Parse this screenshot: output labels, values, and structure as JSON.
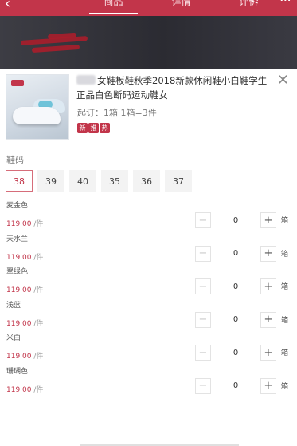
{
  "header": {
    "tabs": [
      {
        "label": "商品",
        "active": true
      },
      {
        "label": "详情",
        "active": false
      },
      {
        "label": "评价",
        "active": false
      }
    ]
  },
  "product": {
    "title": "女鞋板鞋秋季2018新款休闲鞋小白鞋学生正品白色断码运动鞋女",
    "moq": "起订：1箱 1箱=3件",
    "badges": [
      "新",
      "推",
      "热"
    ]
  },
  "size_section": {
    "label": "鞋码",
    "options": [
      "38",
      "39",
      "40",
      "35",
      "36",
      "37"
    ],
    "selected": "38"
  },
  "variants": [
    {
      "color": "麦金色",
      "price": "119.00",
      "unit": "/件",
      "qty": "0"
    },
    {
      "color": "天水兰",
      "price": "119.00",
      "unit": "/件",
      "qty": "0"
    },
    {
      "color": "翠绿色",
      "price": "119.00",
      "unit": "/件",
      "qty": "0"
    },
    {
      "color": "浅蓝",
      "price": "119.00",
      "unit": "/件",
      "qty": "0"
    },
    {
      "color": "米白",
      "price": "119.00",
      "unit": "/件",
      "qty": "0"
    },
    {
      "color": "珊瑚色",
      "price": "119.00",
      "unit": "/件",
      "qty": "0"
    }
  ],
  "stepper": {
    "minus": "−",
    "plus": "+",
    "box_label": "箱"
  },
  "icons": {
    "close": "close-icon",
    "back": "back-arrow-icon",
    "share": "share-icon",
    "more": "more-icon"
  },
  "colors": {
    "accent": "#c2354a"
  }
}
